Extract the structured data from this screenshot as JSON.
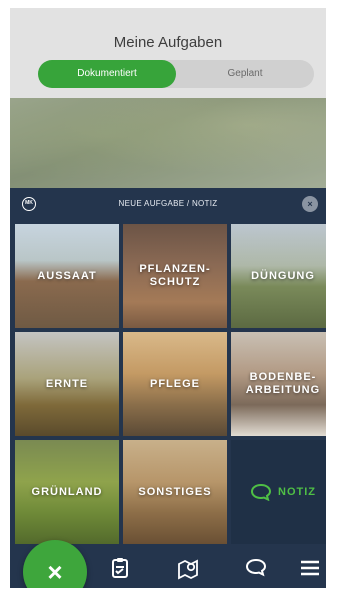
{
  "header": {
    "title": "Meine Aufgaben"
  },
  "segments": {
    "active": "Dokumentiert",
    "inactive": "Geplant"
  },
  "sheet": {
    "badge": "MK",
    "title": "NEUE AUFGABE / NOTIZ",
    "close_icon": "close-icon"
  },
  "tiles": [
    {
      "label": "AUSSAAT"
    },
    {
      "label": "PFLANZEN-\nSCHUTZ"
    },
    {
      "label": "DÜNGUNG"
    },
    {
      "label": "ERNTE"
    },
    {
      "label": "PFLEGE"
    },
    {
      "label": "BODENBE-\nARBEITUNG"
    },
    {
      "label": "GRÜNLAND"
    },
    {
      "label": "SONSTIGES"
    },
    {
      "label": "NOTIZ",
      "icon": "speech-bubble-icon"
    }
  ],
  "tabbar": {
    "fab_icon": "close-icon",
    "items": [
      {
        "icon": "clipboard-check-icon"
      },
      {
        "icon": "map-pin-icon"
      },
      {
        "icon": "speech-bubble-icon"
      },
      {
        "icon": "menu-icon"
      }
    ]
  },
  "colors": {
    "accent_green": "#37a43a",
    "sheet_navy": "#24354d",
    "notiz_green": "#4fbf45"
  }
}
